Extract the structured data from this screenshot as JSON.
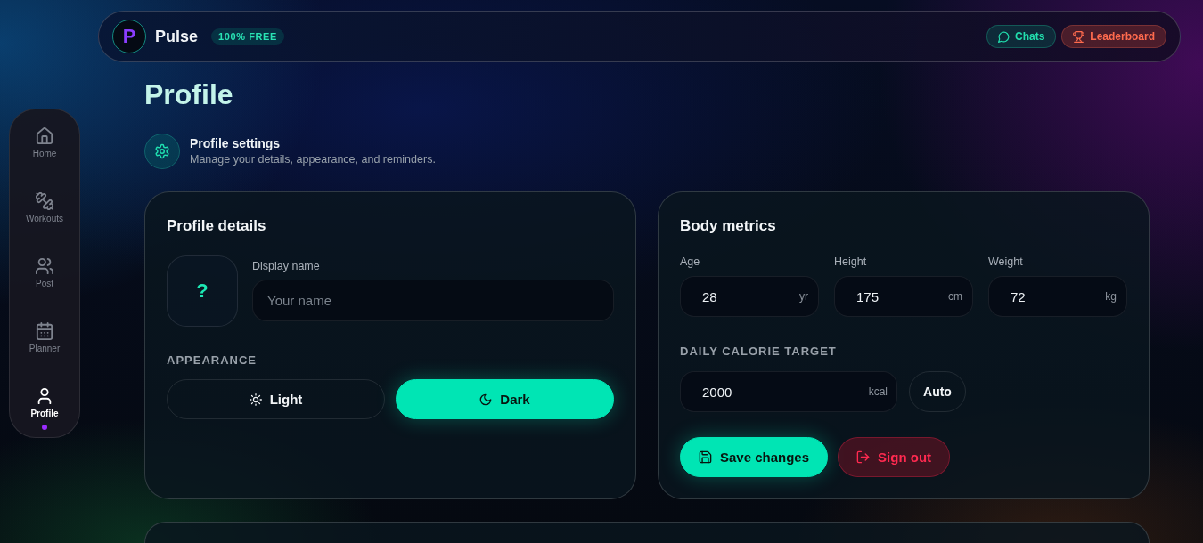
{
  "header": {
    "logo": "P",
    "brand": "Pulse",
    "badge": "100% FREE",
    "actions": [
      {
        "label": "Chats",
        "kind": "chats"
      },
      {
        "label": "Leaderboard",
        "kind": "leaderboard"
      }
    ]
  },
  "sidebar": {
    "items": [
      {
        "label": "Home",
        "kind": "home",
        "selected": false
      },
      {
        "label": "Workouts",
        "kind": "workouts",
        "selected": false
      },
      {
        "label": "Post",
        "kind": "post",
        "selected": false
      },
      {
        "label": "Planner",
        "kind": "planner",
        "selected": false
      },
      {
        "label": "Profile",
        "kind": "profile",
        "selected": true
      }
    ]
  },
  "page": {
    "title": "Profile",
    "section": {
      "title": "Profile settings",
      "subtitle": "Manage your details, appearance, and reminders."
    }
  },
  "profile_details": {
    "title": "Profile details",
    "avatar": "?",
    "display_name": {
      "label": "Display name",
      "placeholder": "Your name"
    },
    "appearance": {
      "label": "APPEARANCE",
      "options": [
        {
          "label": "Light",
          "kind": "light",
          "selected": false
        },
        {
          "label": "Dark",
          "kind": "dark",
          "selected": true
        }
      ]
    }
  },
  "body_metrics": {
    "title": "Body metrics",
    "fields": [
      {
        "label": "Age",
        "value": "28",
        "unit": "yr"
      },
      {
        "label": "Height",
        "value": "175",
        "unit": "cm"
      },
      {
        "label": "Weight",
        "value": "72",
        "unit": "kg"
      }
    ],
    "calorie_target": {
      "label": "DAILY CALORIE TARGET",
      "value": "2000",
      "unit": "kcal",
      "button": "Auto"
    },
    "actions": [
      {
        "label": "Save changes",
        "kind": "save"
      },
      {
        "label": "Sign out",
        "kind": "sign_out"
      }
    ]
  }
}
